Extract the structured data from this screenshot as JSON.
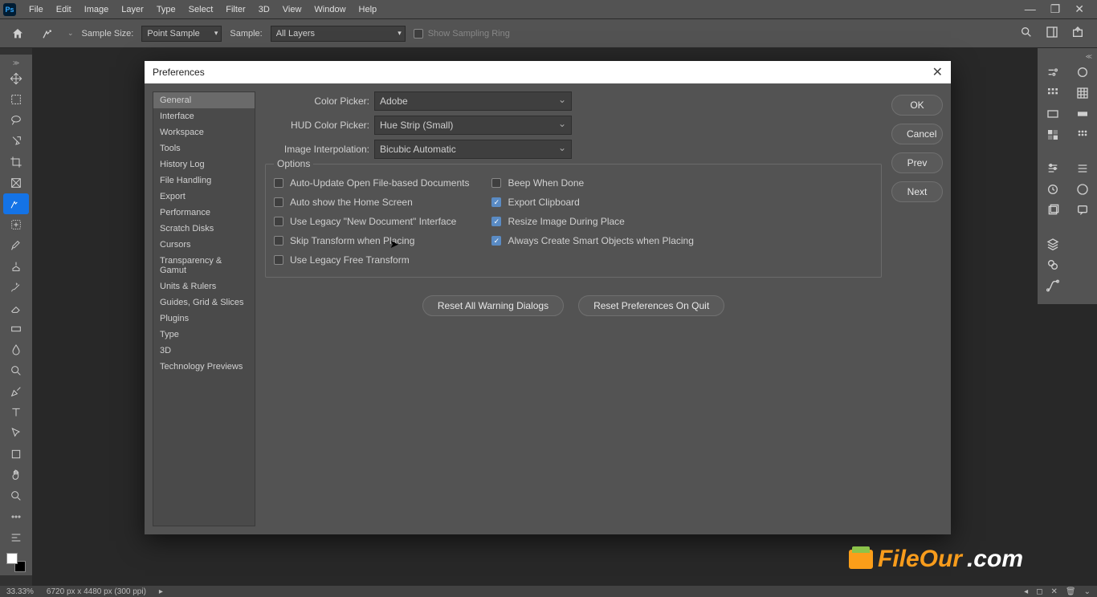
{
  "menubar": {
    "items": [
      "File",
      "Edit",
      "Image",
      "Layer",
      "Type",
      "Select",
      "Filter",
      "3D",
      "View",
      "Window",
      "Help"
    ]
  },
  "optbar": {
    "sample_size_label": "Sample Size:",
    "sample_size_value": "Point Sample",
    "sample_label": "Sample:",
    "sample_value": "All Layers",
    "show_sampling_ring": "Show Sampling Ring"
  },
  "dialog": {
    "title": "Preferences",
    "sidebar": {
      "items": [
        "General",
        "Interface",
        "Workspace",
        "Tools",
        "History Log",
        "File Handling",
        "Export",
        "Performance",
        "Scratch Disks",
        "Cursors",
        "Transparency & Gamut",
        "Units & Rulers",
        "Guides, Grid & Slices",
        "Plugins",
        "Type",
        "3D",
        "Technology Previews"
      ],
      "selected_index": 0
    },
    "fields": {
      "color_picker_label": "Color Picker:",
      "color_picker_value": "Adobe",
      "hud_label": "HUD Color Picker:",
      "hud_value": "Hue Strip (Small)",
      "interp_label": "Image Interpolation:",
      "interp_value": "Bicubic Automatic"
    },
    "options_legend": "Options",
    "options_left": [
      {
        "label": "Auto-Update Open File-based Documents",
        "checked": false
      },
      {
        "label": "Auto show the Home Screen",
        "checked": false
      },
      {
        "label": "Use Legacy \"New Document\" Interface",
        "checked": false
      },
      {
        "label": "Skip Transform when Placing",
        "checked": false
      },
      {
        "label": "Use Legacy Free Transform",
        "checked": false
      }
    ],
    "options_right": [
      {
        "label": "Beep When Done",
        "checked": false
      },
      {
        "label": "Export Clipboard",
        "checked": true
      },
      {
        "label": "Resize Image During Place",
        "checked": true
      },
      {
        "label": "Always Create Smart Objects when Placing",
        "checked": true
      }
    ],
    "buttons": {
      "reset_warnings": "Reset All Warning Dialogs",
      "reset_on_quit": "Reset Preferences On Quit",
      "ok": "OK",
      "cancel": "Cancel",
      "prev": "Prev",
      "next": "Next"
    }
  },
  "statusbar": {
    "zoom": "33.33%",
    "doc_info": "6720 px x 4480 px (300 ppi)"
  },
  "watermark": {
    "a": "FileOur",
    "b": ".com"
  }
}
